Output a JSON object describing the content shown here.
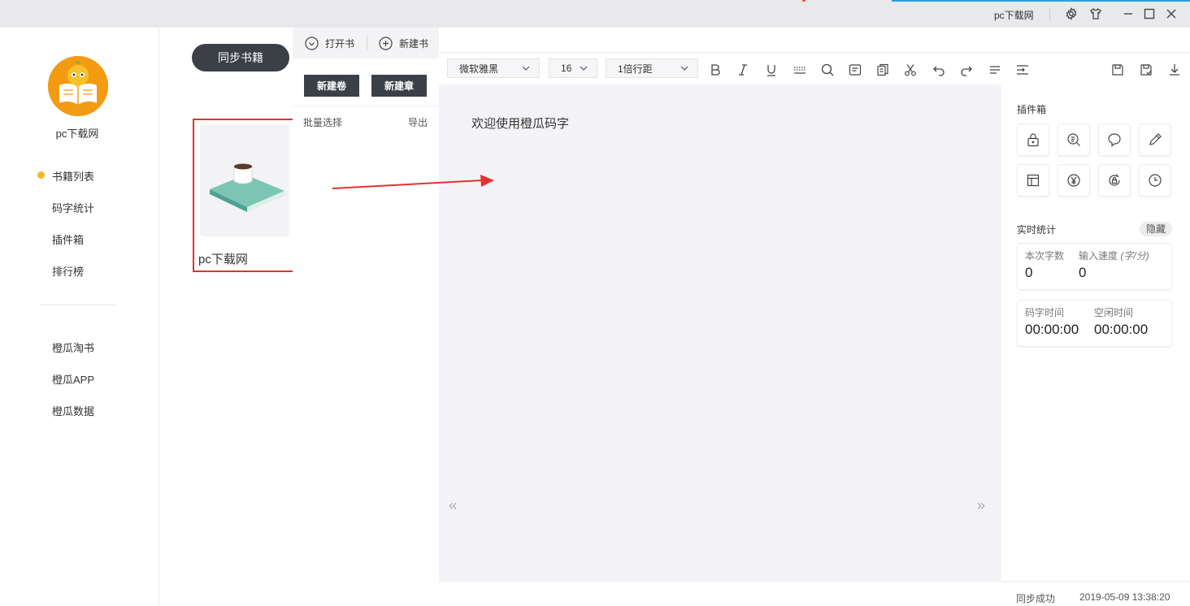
{
  "titlebar": {
    "app_name": "pc下载网"
  },
  "nav": {
    "brand": "pc下载网",
    "items": [
      "书籍列表",
      "码字统计",
      "插件箱",
      "排行榜"
    ],
    "links": [
      "橙瓜淘书",
      "橙瓜APP",
      "橙瓜数据"
    ],
    "active_index": 0
  },
  "shelf": {
    "sync_label": "同步书籍",
    "book_title": "pc下载网"
  },
  "chapters": {
    "open_book": "打开书",
    "new_book": "新建书",
    "new_volume": "新建卷",
    "new_chapter": "新建章",
    "batch_select": "批量选择",
    "export": "导出"
  },
  "toolbar": {
    "font": "微软雅黑",
    "size": "16",
    "line_spacing": "1倍行距"
  },
  "editor": {
    "content": "欢迎使用橙瓜码字",
    "prev_page": "«",
    "next_page": "»"
  },
  "panel": {
    "plugins_title": "插件箱",
    "plugin_icons": [
      "lock-icon",
      "dictionary-search-icon",
      "chat-bubble-icon",
      "pencil-icon",
      "table-icon",
      "yen-icon",
      "lock-rotate-icon",
      "clock-icon"
    ],
    "stats_title": "实时统计",
    "hide_label": "隐藏",
    "stats": {
      "session_chars_label": "本次字数",
      "session_chars": "0",
      "speed_label": "输入速度",
      "speed_unit": "(字/分)",
      "speed": "0",
      "typing_time_label": "码字时间",
      "typing_time": "00:00:00",
      "idle_time_label": "空闲时间",
      "idle_time": "00:00:00"
    }
  },
  "status": {
    "sync_status": "同步成功",
    "timestamp": "2019-05-09 13:38:20"
  },
  "colors": {
    "accent": "#f5b52c",
    "dark_button": "#3b3f46",
    "highlight": "#e5312f",
    "title_accent": "#29a3d6"
  }
}
